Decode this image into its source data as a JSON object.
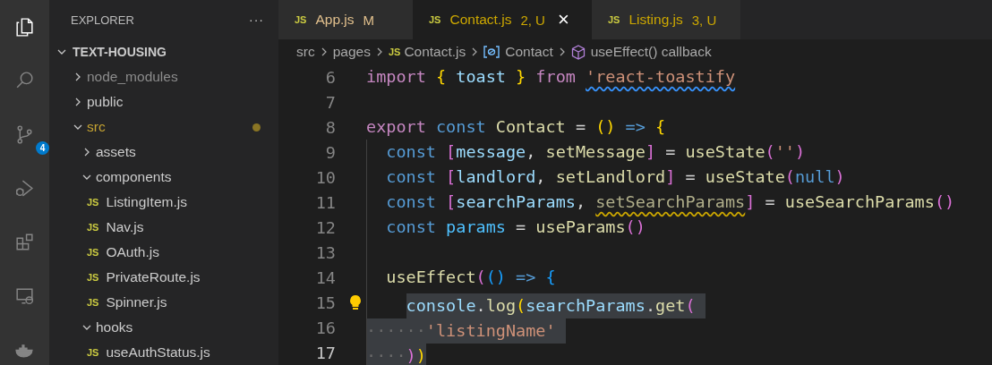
{
  "activity_bar": [
    {
      "kind": "explorer",
      "selected": true
    },
    {
      "kind": "search",
      "selected": false
    },
    {
      "kind": "source-control",
      "selected": false,
      "badge": "4"
    },
    {
      "kind": "run-debug",
      "selected": false
    },
    {
      "kind": "extensions",
      "selected": false
    },
    {
      "kind": "remote",
      "selected": false
    },
    {
      "kind": "docker",
      "selected": false
    }
  ],
  "sidebar": {
    "title": "EXPLORER",
    "actions": "···",
    "tree": {
      "label": "TEXT-HOUSING",
      "expanded": true,
      "children": [
        {
          "label": "node_modules",
          "kind": "folder",
          "expanded": false,
          "color": "#8c8c8c"
        },
        {
          "label": "public",
          "kind": "folder",
          "expanded": false
        },
        {
          "label": "src",
          "kind": "folder",
          "expanded": true,
          "color": "#c5a332",
          "modified": true,
          "children": [
            {
              "label": "assets",
              "kind": "folder",
              "expanded": false
            },
            {
              "label": "components",
              "kind": "folder",
              "expanded": true,
              "children": [
                {
                  "label": "ListingItem.js",
                  "kind": "file",
                  "icon": "JS"
                },
                {
                  "label": "Nav.js",
                  "kind": "file",
                  "icon": "JS"
                },
                {
                  "label": "OAuth.js",
                  "kind": "file",
                  "icon": "JS"
                },
                {
                  "label": "PrivateRoute.js",
                  "kind": "file",
                  "icon": "JS"
                },
                {
                  "label": "Spinner.js",
                  "kind": "file",
                  "icon": "JS"
                }
              ]
            },
            {
              "label": "hooks",
              "kind": "folder",
              "expanded": true,
              "children": [
                {
                  "label": "useAuthStatus.js",
                  "kind": "file",
                  "icon": "JS"
                }
              ]
            }
          ]
        }
      ]
    }
  },
  "tabs": [
    {
      "icon": "JS",
      "label": "App.js",
      "badge": "M",
      "color": "#e2c08d",
      "selected": false
    },
    {
      "icon": "JS",
      "label": "Contact.js",
      "badge": "2, U",
      "color": "#cca700",
      "selected": true,
      "close": "×"
    },
    {
      "icon": "JS",
      "label": "Listing.js",
      "badge": "3, U",
      "color": "#cca700",
      "selected": false
    }
  ],
  "breadcrumbs": [
    {
      "kind": "folder",
      "label": "src"
    },
    {
      "kind": "folder",
      "label": "pages"
    },
    {
      "kind": "file",
      "icon": "JS",
      "label": "Contact.js"
    },
    {
      "kind": "variable",
      "label": "Contact"
    },
    {
      "kind": "method",
      "label": "useEffect() callback"
    }
  ],
  "editor": {
    "lines": [
      {
        "number": "6",
        "tokens": [
          {
            "text": "import ",
            "kind": "keyword"
          },
          {
            "text": "{",
            "kind": "bracket1"
          },
          {
            "text": " toast ",
            "kind": "variable"
          },
          {
            "text": "}",
            "kind": "bracket1"
          },
          {
            "text": " from ",
            "kind": "keyword"
          },
          {
            "text": "'react-toastify",
            "kind": "string",
            "info_squiggle": true
          }
        ]
      },
      {
        "number": "7"
      },
      {
        "number": "8",
        "tokens": [
          {
            "text": "export ",
            "kind": "keyword"
          },
          {
            "text": "const ",
            "kind": "storage"
          },
          {
            "text": "Contact",
            "kind": "function"
          },
          {
            "text": " = ",
            "kind": "plain"
          },
          {
            "text": "()",
            "kind": "bracket1"
          },
          {
            "text": " => ",
            "kind": "storage"
          },
          {
            "text": "{",
            "kind": "bracket1"
          }
        ]
      },
      {
        "number": "9",
        "tokens": [
          {
            "text": "  const ",
            "kind": "storage"
          },
          {
            "text": "[",
            "kind": "bracket2"
          },
          {
            "text": "message",
            "kind": "variable"
          },
          {
            "text": ", ",
            "kind": "plain"
          },
          {
            "text": "setMessage",
            "kind": "function"
          },
          {
            "text": "]",
            "kind": "bracket2"
          },
          {
            "text": " = ",
            "kind": "plain"
          },
          {
            "text": "useState",
            "kind": "function"
          },
          {
            "text": "(",
            "kind": "bracket2"
          },
          {
            "text": "''",
            "kind": "string"
          },
          {
            "text": ")",
            "kind": "bracket2"
          }
        ]
      },
      {
        "number": "10",
        "tokens": [
          {
            "text": "  const ",
            "kind": "storage"
          },
          {
            "text": "[",
            "kind": "bracket2"
          },
          {
            "text": "landlord",
            "kind": "variable"
          },
          {
            "text": ", ",
            "kind": "plain"
          },
          {
            "text": "setLandlord",
            "kind": "function"
          },
          {
            "text": "]",
            "kind": "bracket2"
          },
          {
            "text": " = ",
            "kind": "plain"
          },
          {
            "text": "useState",
            "kind": "function"
          },
          {
            "text": "(",
            "kind": "bracket2"
          },
          {
            "text": "null",
            "kind": "storage"
          },
          {
            "text": ")",
            "kind": "bracket2"
          }
        ]
      },
      {
        "number": "11",
        "tokens": [
          {
            "text": "  const ",
            "kind": "storage"
          },
          {
            "text": "[",
            "kind": "bracket2"
          },
          {
            "text": "searchParams",
            "kind": "variable"
          },
          {
            "text": ", ",
            "kind": "plain"
          },
          {
            "text": "setSearchParams",
            "kind": "unused",
            "warning_squiggle": true
          },
          {
            "text": "]",
            "kind": "bracket2"
          },
          {
            "text": " = ",
            "kind": "plain"
          },
          {
            "text": "useSearchParams",
            "kind": "function"
          },
          {
            "text": "()",
            "kind": "bracket2"
          }
        ]
      },
      {
        "number": "12",
        "tokens": [
          {
            "text": "  const ",
            "kind": "storage"
          },
          {
            "text": "params",
            "kind": "constant"
          },
          {
            "text": " = ",
            "kind": "plain"
          },
          {
            "text": "useParams",
            "kind": "function"
          },
          {
            "text": "()",
            "kind": "bracket2"
          }
        ]
      },
      {
        "number": "13"
      },
      {
        "number": "14",
        "tokens": [
          {
            "text": "  useEffect",
            "kind": "function"
          },
          {
            "text": "(",
            "kind": "bracket2"
          },
          {
            "text": "()",
            "kind": "bracket3"
          },
          {
            "text": " => ",
            "kind": "storage"
          },
          {
            "text": "{",
            "kind": "bracket3"
          }
        ]
      },
      {
        "number": "15",
        "lightbulb": true,
        "tokens": [
          {
            "text": "    console",
            "kind": "variable",
            "selected": true
          },
          {
            "text": ".",
            "kind": "plain",
            "selected": true
          },
          {
            "text": "log",
            "kind": "function",
            "selected": true
          },
          {
            "text": "(",
            "kind": "bracket1",
            "selected": true
          },
          {
            "text": "searchParams",
            "kind": "variable",
            "selected": true
          },
          {
            "text": ".",
            "kind": "plain",
            "selected": true
          },
          {
            "text": "get",
            "kind": "function",
            "selected": true
          },
          {
            "text": "( ",
            "kind": "bracket2",
            "selected": true
          }
        ]
      },
      {
        "number": "16",
        "tokens": [
          {
            "text": "······",
            "kind": "whitespace",
            "selected": true
          },
          {
            "text": "'listingName' ",
            "kind": "string",
            "selected": true
          }
        ]
      },
      {
        "number": "17",
        "current": true,
        "tokens": [
          {
            "text": "····",
            "kind": "whitespace",
            "selected": true
          },
          {
            "text": ")",
            "kind": "bracket2",
            "selected": true
          },
          {
            "text": ")",
            "kind": "bracket1",
            "selected": true
          }
        ]
      }
    ]
  }
}
